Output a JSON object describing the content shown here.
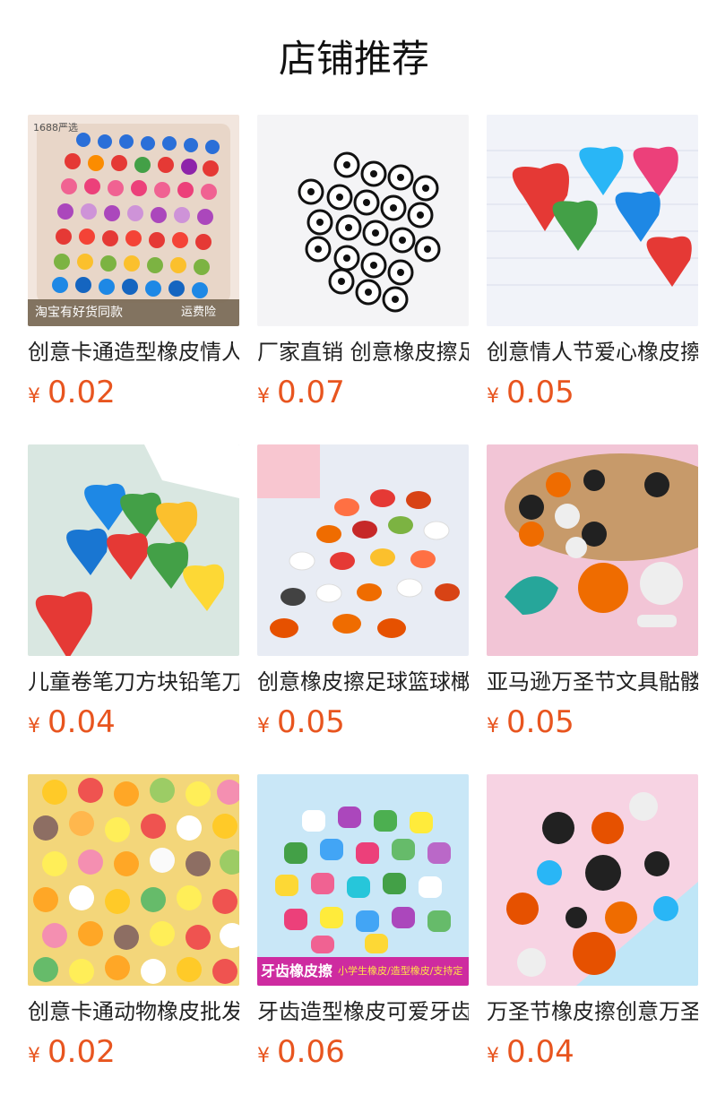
{
  "section_title": "店铺推荐",
  "products": [
    {
      "name": "创意卡通造型橡皮情人节爱心",
      "currency": "¥",
      "price": "0.02",
      "badge_top": "1688严选",
      "badge_left": "淘宝有好货同款",
      "badge_right": "运费险"
    },
    {
      "name": "厂家直销 创意橡皮擦足球",
      "currency": "¥",
      "price": "0.07"
    },
    {
      "name": "创意情人节爱心橡皮擦",
      "currency": "¥",
      "price": "0.05"
    },
    {
      "name": "儿童卷笔刀方块铅笔刀",
      "currency": "¥",
      "price": "0.04"
    },
    {
      "name": "创意橡皮擦足球篮球橄榄球",
      "currency": "¥",
      "price": "0.05"
    },
    {
      "name": "亚马逊万圣节文具骷髅",
      "currency": "¥",
      "price": "0.05"
    },
    {
      "name": "创意卡通动物橡皮批发",
      "currency": "¥",
      "price": "0.02"
    },
    {
      "name": "牙齿造型橡皮可爱牙齿",
      "currency": "¥",
      "price": "0.06",
      "banner_left": "牙齿橡皮擦",
      "banner_right": "小学生橡皮/造型橡皮/支持定做"
    },
    {
      "name": "万圣节橡皮擦创意万圣节",
      "currency": "¥",
      "price": "0.04"
    }
  ]
}
